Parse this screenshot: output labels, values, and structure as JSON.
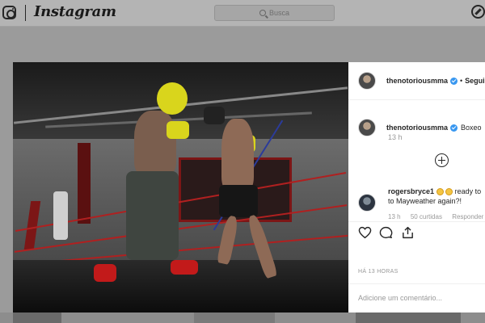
{
  "app": {
    "wordmark": "Instagram"
  },
  "search": {
    "placeholder": "Busca"
  },
  "post": {
    "author": "thenotoriousmma",
    "follow_label": "Seguir",
    "separator": "•",
    "caption": "Boxeo",
    "caption_time": "13 h",
    "comments": [
      {
        "author": "rogersbryce1",
        "text_line1": "ready to",
        "text_line2": "to Mayweather again?!",
        "time": "13 h",
        "likes": "50 curtidas",
        "reply_label": "Responder"
      }
    ],
    "posted_ago": "HÁ 13 HORAS",
    "add_comment_placeholder": "Adicione um comentário..."
  },
  "icons": {
    "logo": "instagram-glyph-icon",
    "compass": "compass-icon",
    "search": "search-icon",
    "verified": "verified-badge-icon",
    "load_more": "plus-circle-icon",
    "like": "heart-icon",
    "comment": "comment-bubble-icon",
    "share": "share-icon"
  },
  "colors": {
    "verified": "#3897f0",
    "overlay": "#9b9b9b",
    "panel": "#ffffff"
  }
}
